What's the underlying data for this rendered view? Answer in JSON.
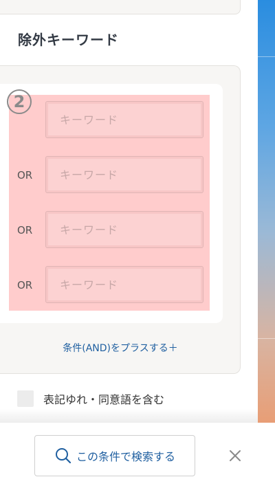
{
  "section": {
    "title": "除外キーワード"
  },
  "badge": "2",
  "keywords": [
    {
      "prefix": "",
      "placeholder": "キーワード"
    },
    {
      "prefix": "OR",
      "placeholder": "キーワード"
    },
    {
      "prefix": "OR",
      "placeholder": "キーワード"
    },
    {
      "prefix": "OR",
      "placeholder": "キーワード"
    }
  ],
  "add_condition_label": "条件(AND)をプラスする＋",
  "synonym_option": {
    "label": "表記ゆれ・同意語を含む",
    "checked": false
  },
  "footer": {
    "search_label": "この条件で検索する",
    "search_icon": "search-icon",
    "close_icon": "close-icon"
  },
  "colors": {
    "accent": "#1f5fa0",
    "highlight": "#ffcccc",
    "panel_bg": "#f7f6f4"
  }
}
